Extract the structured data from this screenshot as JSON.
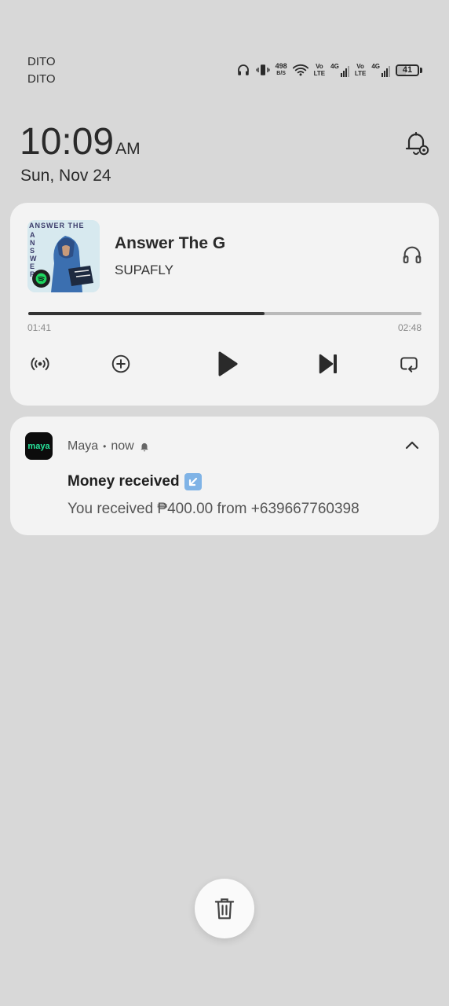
{
  "status_bar": {
    "carriers": [
      "DITO",
      "DITO"
    ],
    "net_speed_value": "498",
    "net_speed_unit": "B/S",
    "volte_label": "Vo",
    "volte_sub": "LTE",
    "network_type": "4G",
    "battery_level": "41",
    "battery_fraction": 0.41,
    "icons": [
      "headphones-icon",
      "vibrate-icon",
      "wifi-icon",
      "signal-icon",
      "battery-icon"
    ]
  },
  "clock": {
    "time": "10:09",
    "ampm": "AM",
    "date": "Sun, Nov 24"
  },
  "media": {
    "title": "Answer The G",
    "artist": "SUPAFLY",
    "album_art_text": "ANSWER THE",
    "album_art_side_text": "ANSWER",
    "elapsed": "01:41",
    "total": "02:48",
    "progress_fraction": 0.601,
    "controls": [
      "cast-icon",
      "add-icon",
      "play-icon",
      "skip-next-icon",
      "repeat-icon"
    ]
  },
  "notification": {
    "app_icon_text": "maya",
    "app": "Maya",
    "separator": "•",
    "time": "now",
    "title": "Money received",
    "body": "You received ₱400.00 from +639667760398"
  },
  "colors": {
    "background": "#d8d8d8",
    "card": "#f3f3f3",
    "maya_green": "#27e39a",
    "spotify_green": "#1ed760"
  }
}
